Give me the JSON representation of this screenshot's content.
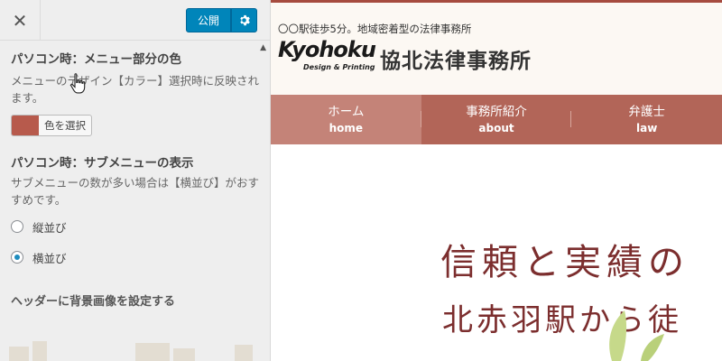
{
  "customizer": {
    "close_icon": "close-icon",
    "publish_label": "公開",
    "settings_icon": "gear-icon",
    "menu_color": {
      "title": "パソコン時：メニュー部分の色",
      "description": "メニューのデザイン【カラー】選択時に反映されます。",
      "button_label": "色を選択",
      "swatch_color": "#b75a4c"
    },
    "submenu": {
      "title": "パソコン時：サブメニューの表示",
      "description": "サブメニューの数が多い場合は【横並び】がおすすめです。",
      "options": [
        {
          "label": "縦並び",
          "checked": false
        },
        {
          "label": "横並び",
          "checked": true
        }
      ]
    },
    "header_image_link": "ヘッダーに背景画像を設定する"
  },
  "preview": {
    "tagline": "〇〇駅徒歩5分。地域密着型の法律事務所",
    "logo_en": "Kyohoku",
    "logo_sub": "Design & Printing",
    "logo_jp": "協北法律事務所",
    "nav": [
      {
        "jp": "ホーム",
        "en": "home"
      },
      {
        "jp": "事務所紹介",
        "en": "about"
      },
      {
        "jp": "弁護士",
        "en": "law"
      }
    ],
    "hero_line1": "信頼と実績の",
    "hero_line2": "北赤羽駅から徒",
    "accent_color": "#b26558"
  }
}
